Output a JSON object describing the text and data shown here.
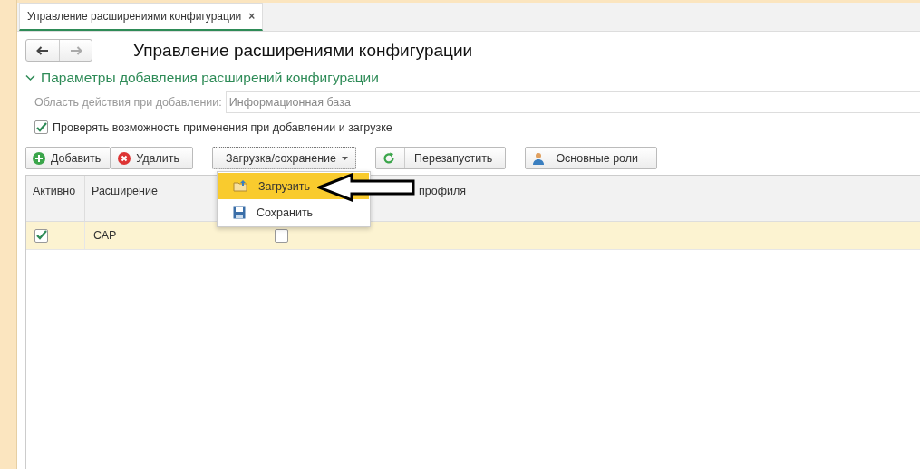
{
  "tab": {
    "title": "Управление расширениями конфигурации",
    "close": "×",
    "selected": true
  },
  "title": "Управление расширениями конфигурации",
  "section": {
    "title": "Параметры добавления расширений конфигурации",
    "expanded": true
  },
  "scope_field": {
    "label": "Область действия при добавлении:",
    "value": "Информационная база"
  },
  "check_option": {
    "label": "Проверять возможность применения при добавлении и загрузке",
    "checked": true
  },
  "toolbar": [
    {
      "label": "Добавить"
    },
    {
      "label": "Удалить"
    },
    {
      "label": "Загрузка/сохранение"
    },
    {
      "label": "Перезапустить"
    },
    {
      "label": "Основные роли"
    }
  ],
  "menu": [
    {
      "label": "Загрузить",
      "selected": true
    },
    {
      "label": "Сохранить",
      "selected": false
    }
  ],
  "table": {
    "columns": [
      "Активно",
      "Расширение",
      "профиля"
    ],
    "rows": [
      {
        "active": true,
        "name": "САР",
        "column_3": false,
        "selected": true
      }
    ]
  }
}
